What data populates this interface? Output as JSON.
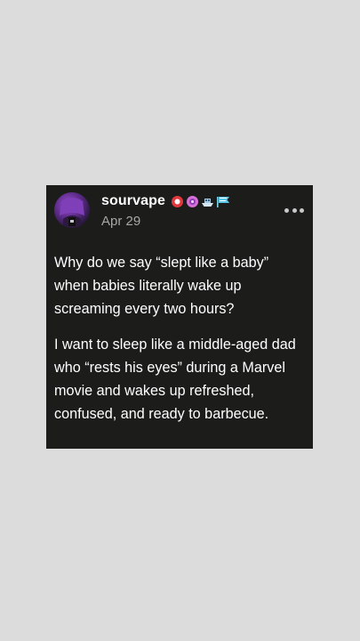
{
  "post": {
    "username": "sourvape",
    "date": "Apr 29",
    "badges": [
      "red-badge-icon",
      "pink-flower-badge-icon",
      "boat-badge-icon",
      "flag-badge-icon"
    ],
    "paragraphs": [
      "Why do we say “slept like a baby” when babies literally wake up screaming every two hours?",
      "I want to sleep like a middle-aged dad who “rests his eyes” during a Marvel movie and wakes up refreshed, confused, and ready to barbecue."
    ]
  },
  "colors": {
    "background": "#dcdcdc",
    "card": "#1c1c1b",
    "text": "#ffffff",
    "muted": "#a7a7a7"
  }
}
